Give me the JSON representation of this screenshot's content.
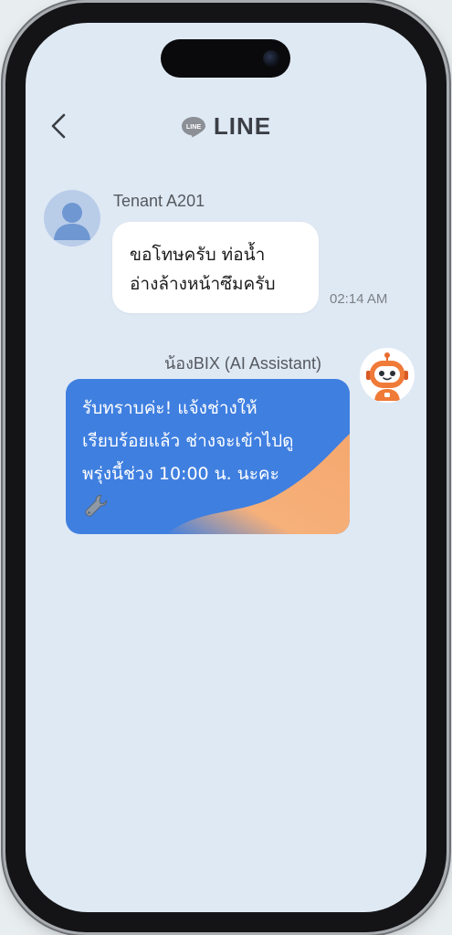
{
  "header": {
    "back_icon": "chevron-left-icon",
    "logo_badge": "LINE",
    "app_name": "LINE"
  },
  "messages": [
    {
      "sender": "Tenant A201",
      "avatar_icon": "person-avatar-icon",
      "text": "ขอโทษครับ ท่อน้ำ\nอ่างล้างหน้าซึมครับ",
      "time": "02:14 AM"
    },
    {
      "sender": "น้องBIX (AI Assistant)",
      "avatar_icon": "robot-avatar-icon",
      "text": "รับทราบค่ะ! แจ้งช่างให้\nเรียบร้อยแล้ว ช่างจะเข้าไปดู\nพรุ่งนี้ช่วง 10:00 น. นะคะ",
      "emoji_icon": "wrench-icon"
    }
  ],
  "colors": {
    "screen_bg": "#dfe9f4",
    "bot_bubble": "#3f7fe0",
    "bot_bubble_accent": "#f6b07a",
    "user_bubble": "#ffffff",
    "line_green": "#06c755"
  }
}
